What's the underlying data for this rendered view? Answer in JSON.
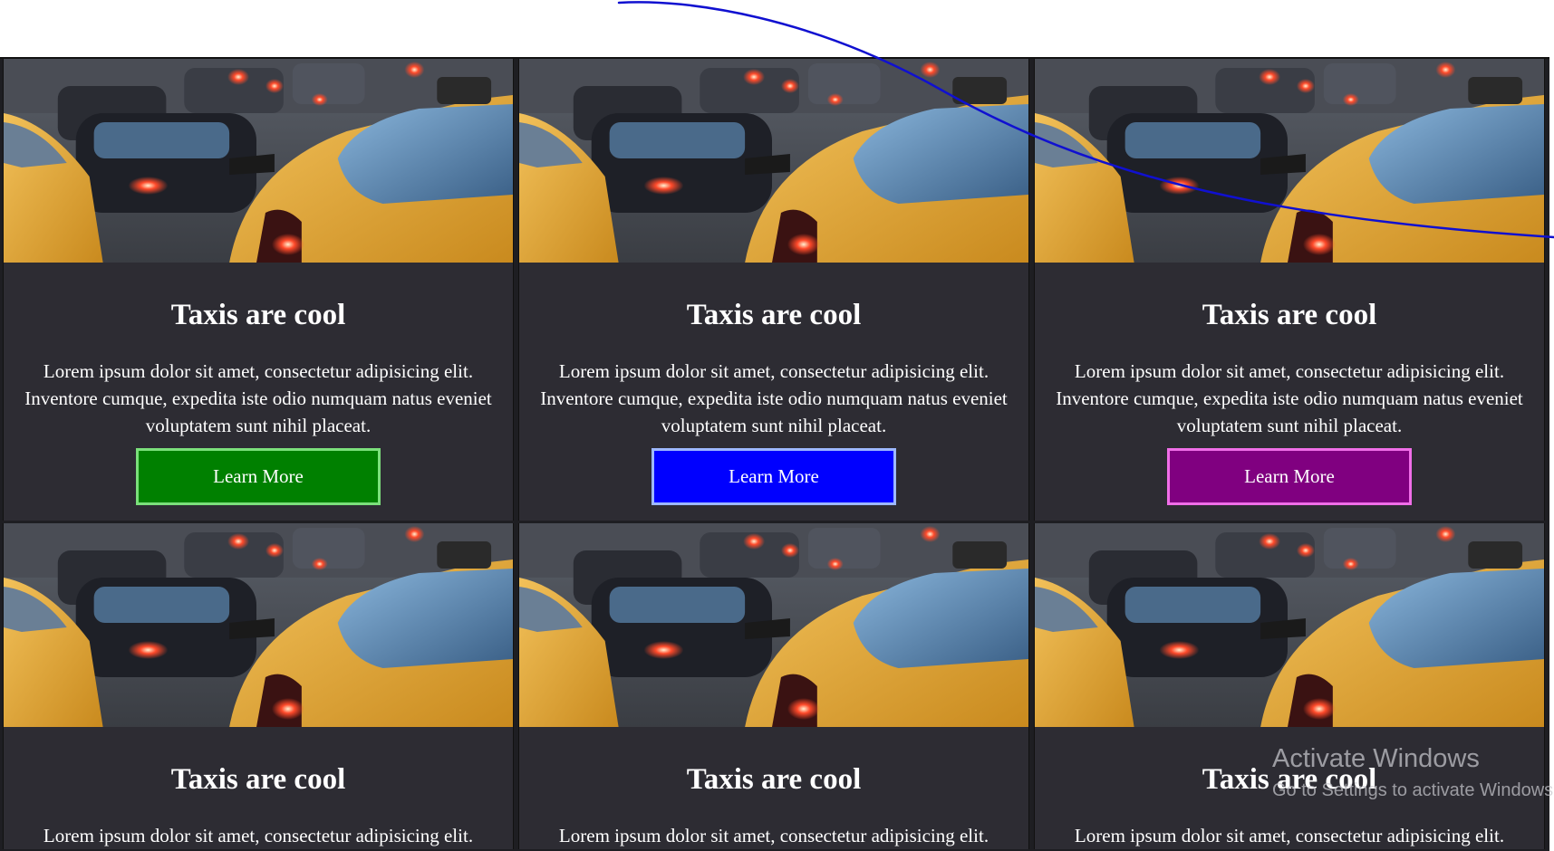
{
  "cards": [
    {
      "title": "Taxis are cool",
      "body": "Lorem ipsum dolor sit amet, consectetur adipisicing elit. Inventore cumque, expedita iste odio numquam natus eveniet voluptatem sunt nihil placeat.",
      "button": "Learn More",
      "button_color": "#008000",
      "button_border": "#7be07b"
    },
    {
      "title": "Taxis are cool",
      "body": "Lorem ipsum dolor sit amet, consectetur adipisicing elit. Inventore cumque, expedita iste odio numquam natus eveniet voluptatem sunt nihil placeat.",
      "button": "Learn More",
      "button_color": "#0000ff",
      "button_border": "#9db8ff"
    },
    {
      "title": "Taxis are cool",
      "body": "Lorem ipsum dolor sit amet, consectetur adipisicing elit. Inventore cumque, expedita iste odio numquam natus eveniet voluptatem sunt nihil placeat.",
      "button": "Learn More",
      "button_color": "#800080",
      "button_border": "#f06ee8"
    },
    {
      "title": "Taxis are cool",
      "body": "Lorem ipsum dolor sit amet, consectetur adipisicing elit."
    },
    {
      "title": "Taxis are cool",
      "body": "Lorem ipsum dolor sit amet, consectetur adipisicing elit."
    },
    {
      "title": "Taxis are cool",
      "body": "Lorem ipsum dolor sit amet, consectetur adipisicing elit."
    }
  ],
  "watermark": {
    "title": "Activate Windows",
    "subtitle": "Go to Settings to activate Windows."
  },
  "colors": {
    "card_bg": "#2d2c33",
    "annotation_stroke": "#1010d0"
  }
}
